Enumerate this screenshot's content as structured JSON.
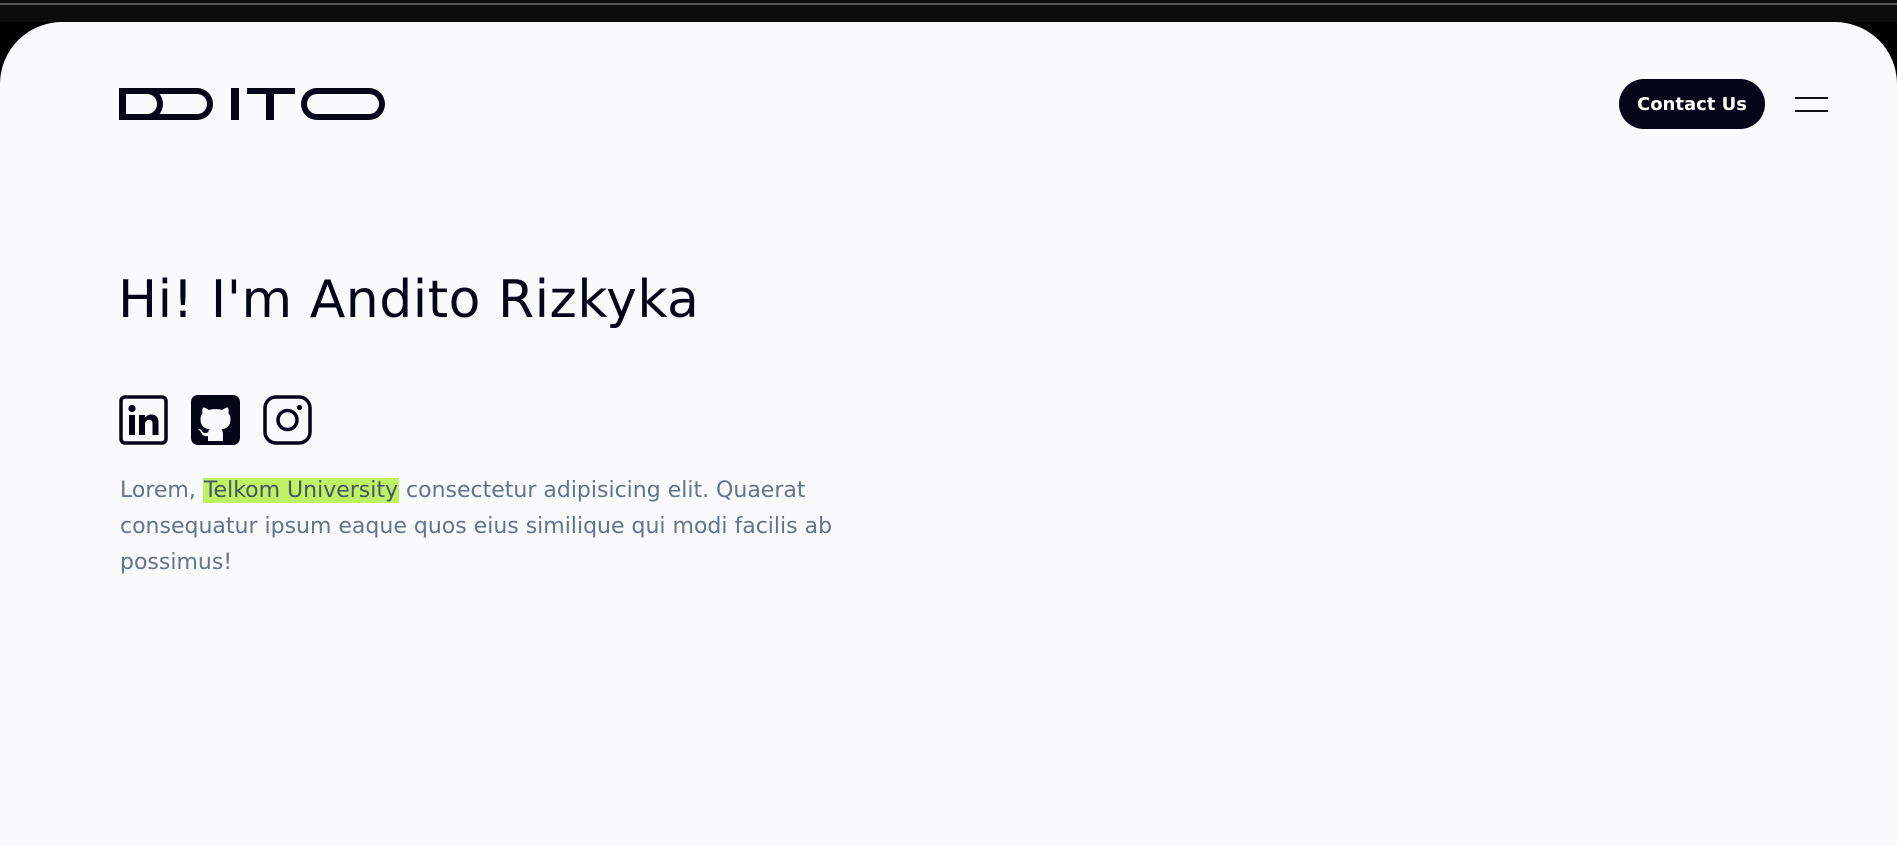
{
  "brand": {
    "logo_icon": "dito-wordmark",
    "logo_text": "DITO"
  },
  "header": {
    "contact_label": "Contact Us",
    "menu_icon": "hamburger-menu-icon"
  },
  "hero": {
    "title": "Hi! I'm Andito Rizkyka",
    "socials": [
      {
        "name": "LinkedIn",
        "icon": "linkedin-icon"
      },
      {
        "name": "GitHub",
        "icon": "github-icon"
      },
      {
        "name": "Instagram",
        "icon": "instagram-icon"
      }
    ],
    "intro_before": "Lorem, ",
    "intro_highlight": "Telkom University",
    "intro_after": " consectetur adipisicing elit. Quaerat consequatur ipsum eaque quos eius similique qui modi facilis ab possimus!"
  },
  "colors": {
    "page_background": "#f8fafc",
    "primary_dark": "#020617",
    "body_text": "#64748b",
    "highlight": "#bef264"
  }
}
